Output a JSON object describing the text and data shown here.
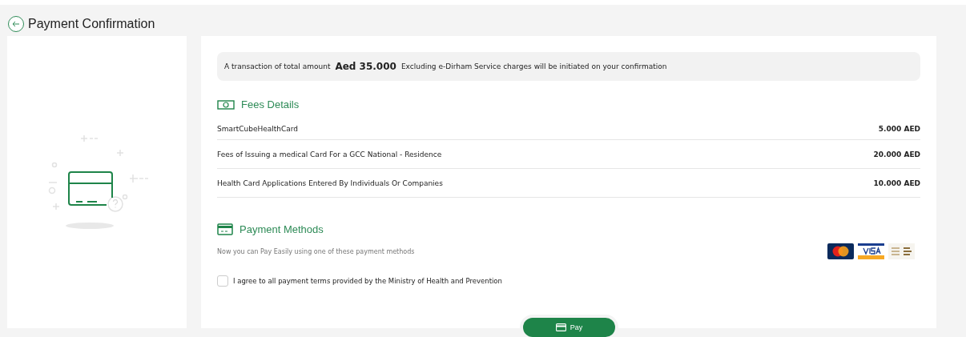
{
  "header": {
    "title": "Payment Confirmation"
  },
  "notice": {
    "text": "A transaction of total amount",
    "amount": "Aed 35.000",
    "suffix": "Excluding e-Dirham Service charges will be initiated on your confirmation"
  },
  "fees": {
    "title": "Fees Details",
    "rows": [
      {
        "name": "SmartCubeHealthCard",
        "amount": "5.000 AED"
      },
      {
        "name": "Fees of Issuing a medical Card For a GCC National - Residence",
        "amount": "20.000 AED"
      },
      {
        "name": "Health Card Applications Entered By Individuals Or Companies",
        "amount": "10.000 AED"
      }
    ]
  },
  "payment_methods": {
    "title": "Payment Methods",
    "subtitle": "Now you can Pay Easily using one of these payment methods",
    "logos": [
      {
        "kind": "mastercard"
      },
      {
        "kind": "visa"
      },
      {
        "kind": "edirham"
      }
    ]
  },
  "agreement": {
    "label": "I agree to all payment terms provided by the Ministry of Health and Prevention",
    "checked": false
  },
  "pay_button": {
    "label": "Pay"
  }
}
